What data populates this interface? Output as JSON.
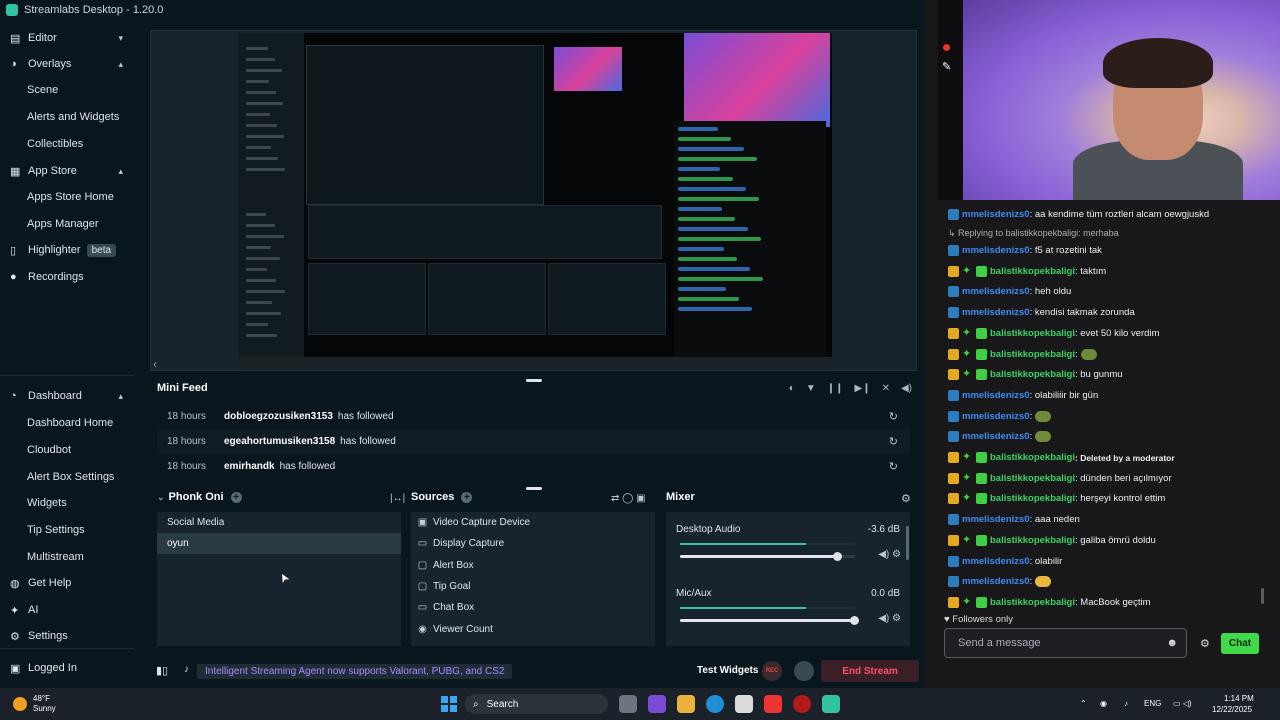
{
  "window": {
    "title": "Streamlabs Desktop - 1.20.0"
  },
  "sidebar": {
    "items": [
      {
        "label": "Editor",
        "type": "section",
        "icon": "editor-icon",
        "chevron": "▾"
      },
      {
        "label": "Overlays",
        "type": "section",
        "icon": "overlays-icon",
        "chevron": "▴"
      },
      {
        "label": "Scene",
        "type": "sub"
      },
      {
        "label": "Alerts and Widgets",
        "type": "sub"
      },
      {
        "label": "Collectibles",
        "type": "sub"
      },
      {
        "label": "App Store",
        "type": "section",
        "icon": "app-store-icon",
        "chevron": "▴"
      },
      {
        "label": "Apps Store Home",
        "type": "sub"
      },
      {
        "label": "Apps Manager",
        "type": "sub"
      },
      {
        "label": "Highlighter",
        "type": "section",
        "icon": "highlighter-icon",
        "badge": "beta"
      },
      {
        "label": "Recordings",
        "type": "section",
        "icon": "recordings-icon"
      },
      {
        "label": "Dashboard",
        "type": "section",
        "icon": "dashboard-icon",
        "chevron": "▴"
      },
      {
        "label": "Dashboard Home",
        "type": "sub"
      },
      {
        "label": "Cloudbot",
        "type": "sub"
      },
      {
        "label": "Alert Box Settings",
        "type": "sub"
      },
      {
        "label": "Widgets",
        "type": "sub"
      },
      {
        "label": "Tip Settings",
        "type": "sub"
      },
      {
        "label": "Multistream",
        "type": "sub"
      },
      {
        "label": "Get Help",
        "type": "section",
        "icon": "help-icon"
      },
      {
        "label": "AI",
        "type": "section",
        "icon": "ai-icon"
      },
      {
        "label": "Settings",
        "type": "section",
        "icon": "settings-icon"
      },
      {
        "label": "Logged In",
        "type": "section",
        "icon": "platforms-icon"
      }
    ]
  },
  "mini_feed": {
    "title": "Mini Feed",
    "events": [
      {
        "time": "18 hours",
        "user": "dobloegzozusiken3153",
        "action": "has followed"
      },
      {
        "time": "18 hours",
        "user": "egeahortumusiken3158",
        "action": "has followed"
      },
      {
        "time": "18 hours",
        "user": "emirhandk",
        "action": "has followed"
      }
    ]
  },
  "scenes": {
    "title": "Phonk Oni",
    "items": [
      "Social Media",
      "oyun"
    ],
    "active": "oyun"
  },
  "sources": {
    "title": "Sources",
    "items": [
      {
        "label": "Video Capture Device",
        "icon": "camera-icon"
      },
      {
        "label": "Display Capture",
        "icon": "monitor-icon"
      },
      {
        "label": "Alert Box",
        "icon": "bell-icon"
      },
      {
        "label": "Tip Goal",
        "icon": "goal-icon"
      },
      {
        "label": "Chat Box",
        "icon": "chat-icon"
      },
      {
        "label": "Viewer Count",
        "icon": "eye-icon"
      }
    ]
  },
  "mixer": {
    "title": "Mixer",
    "channels": [
      {
        "name": "Desktop Audio",
        "db": "-3.6 dB",
        "level": 0.72,
        "volume": 0.9
      },
      {
        "name": "Mic/Aux",
        "db": "0.0 dB",
        "level": 0.72,
        "volume": 1.0
      }
    ]
  },
  "footer": {
    "notification": "Intelligent Streaming Agent now supports Valorant, PUBG, and CS2",
    "test_widgets": "Test Widgets",
    "rec_label": "REC",
    "end_stream": "End Stream"
  },
  "chat": {
    "reply_context": "Replying to balistikkopekbaligi: merhaba",
    "messages": [
      {
        "user": "mmelisdenizs0",
        "color": "blue",
        "text": ": aa kendime tüm roztleri alcam oewgjuskd",
        "badges": [
          "prime"
        ]
      },
      {
        "user": "mmelisdenizs0",
        "color": "blue",
        "text": ": f5 at rozetini tak",
        "badges": [
          "prime"
        ]
      },
      {
        "user": "balistikkopekbaligi",
        "color": "green",
        "text": ": taktım",
        "badges": [
          "crown",
          "star",
          "gift"
        ]
      },
      {
        "user": "mmelisdenizs0",
        "color": "blue",
        "text": ": heh oldu",
        "badges": [
          "prime"
        ]
      },
      {
        "user": "mmelisdenizs0",
        "color": "blue",
        "text": ": kendisi takmak zorunda",
        "badges": [
          "prime"
        ]
      },
      {
        "user": "balistikkopekbaligi",
        "color": "green",
        "text": ": evet 50 kilo verdim",
        "badges": [
          "crown",
          "star",
          "gift"
        ]
      },
      {
        "user": "balistikkopekbaligi",
        "color": "green",
        "text": ":",
        "badges": [
          "crown",
          "star",
          "gift"
        ],
        "emote": "#6f8a3a"
      },
      {
        "user": "balistikkopekbaligi",
        "color": "green",
        "text": ": bu gunmu",
        "badges": [
          "crown",
          "star",
          "gift"
        ]
      },
      {
        "user": "mmelisdenizs0",
        "color": "blue",
        "text": ": olabiliiir bir gün",
        "badges": [
          "prime"
        ]
      },
      {
        "user": "mmelisdenizs0",
        "color": "blue",
        "text": ":",
        "badges": [
          "prime"
        ],
        "emote": "#6f8a3a"
      },
      {
        "user": "mmelisdenizs0",
        "color": "blue",
        "text": ":",
        "badges": [
          "prime"
        ],
        "emote": "#6f8a3a"
      },
      {
        "user": "balistikkopekbaligi",
        "color": "green",
        "text": ": Deleted by a moderator",
        "badges": [
          "crown",
          "star",
          "gift"
        ],
        "deleted": true
      },
      {
        "user": "balistikkopekbaligi",
        "color": "green",
        "text": ": dünden beri açılmıyor",
        "badges": [
          "crown",
          "star",
          "gift"
        ]
      },
      {
        "user": "balistikkopekbaligi",
        "color": "green",
        "text": ": herşeyi kontrol ettim",
        "badges": [
          "crown",
          "star",
          "gift"
        ]
      },
      {
        "user": "mmelisdenizs0",
        "color": "blue",
        "text": ": aaa neden",
        "badges": [
          "prime"
        ]
      },
      {
        "user": "balistikkopekbaligi",
        "color": "green",
        "text": ": galiba ömrü doldu",
        "badges": [
          "crown",
          "star",
          "gift"
        ]
      },
      {
        "user": "mmelisdenizs0",
        "color": "blue",
        "text": ": olabilir",
        "badges": [
          "prime"
        ]
      },
      {
        "user": "mmelisdenizs0",
        "color": "blue",
        "text": ":",
        "badges": [
          "prime"
        ],
        "emote": "#e9b83a"
      },
      {
        "user": "balistikkopekbaligi",
        "color": "green",
        "text": ": MacBook geçtim",
        "badges": [
          "crown",
          "star",
          "gift"
        ]
      }
    ],
    "followers_only": "Followers only",
    "placeholder": "Send a message",
    "send_label": "Chat"
  },
  "taskbar": {
    "weather_temp": "48°F",
    "weather_desc": "Sunny",
    "search_label": "Search",
    "lang": "ENG",
    "time": "1:14 PM",
    "date": "12/22/2025"
  },
  "colors": {
    "accent": "#31c3a2",
    "bg": "#09161d",
    "panel": "#17242d",
    "chat_bg": "#18181b",
    "chat_send": "#41d84a",
    "end_stream": "#ff4f6a"
  }
}
